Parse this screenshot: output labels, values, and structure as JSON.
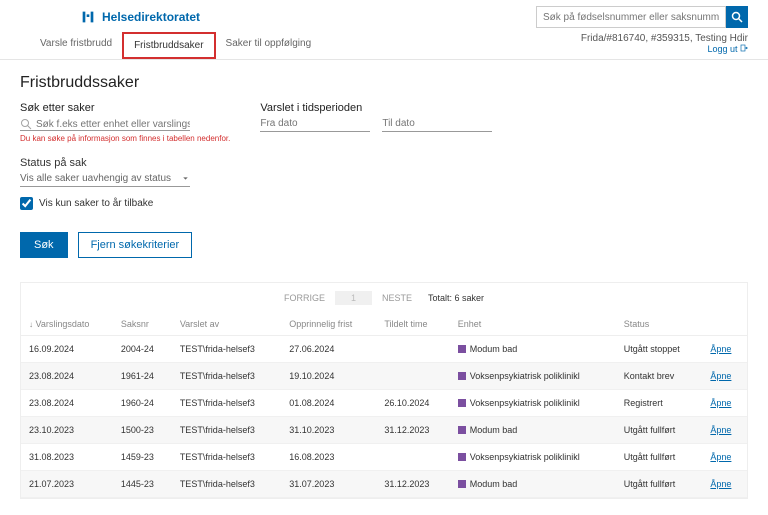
{
  "brand": "Helsedirektoratet",
  "top_search": {
    "placeholder": "Søk på fødselsnummer eller saksnummer"
  },
  "tabs": {
    "t0": "Varsle fristbrudd",
    "t1": "Fristbruddsaker",
    "t2": "Saker til oppfølging"
  },
  "user_line": "Frida/#816740, #359315, Testing Hdir",
  "logout": "Logg ut",
  "page_title": "Fristbruddssaker",
  "search_label": "Søk etter saker",
  "search_placeholder": "Søk f.eks etter enhet eller varslingsdato",
  "search_hint": "Du kan søke på informasjon som finnes i tabellen nedenfor.",
  "period_label": "Varslet i tidsperioden",
  "from_placeholder": "Fra dato",
  "to_placeholder": "Til dato",
  "status_label": "Status på sak",
  "status_value": "Vis alle saker uavhengig av status",
  "checkbox_label": "Vis kun saker to år tilbake",
  "btn_search": "Søk",
  "btn_clear": "Fjern søkekriterier",
  "pager": {
    "prev": "FORRIGE",
    "page": "1",
    "next": "NESTE",
    "total": "Totalt: 6 saker"
  },
  "columns": {
    "c0": "Varslingsdato",
    "c1": "Saksnr",
    "c2": "Varslet av",
    "c3": "Opprinnelig frist",
    "c4": "Tildelt time",
    "c5": "Enhet",
    "c6": "Status",
    "c7": ""
  },
  "apne": "Åpne",
  "rows": [
    {
      "d": "16.09.2024",
      "s": "2004-24",
      "v": "TEST\\frida-helsef3",
      "of": "27.06.2024",
      "tt": "",
      "e": "Modum bad",
      "st": "Utgått stoppet"
    },
    {
      "d": "23.08.2024",
      "s": "1961-24",
      "v": "TEST\\frida-helsef3",
      "of": "19.10.2024",
      "tt": "",
      "e": "Voksenpsykiatrisk poliklinikl",
      "st": "Kontakt brev"
    },
    {
      "d": "23.08.2024",
      "s": "1960-24",
      "v": "TEST\\frida-helsef3",
      "of": "01.08.2024",
      "tt": "26.10.2024",
      "e": "Voksenpsykiatrisk poliklinikl",
      "st": "Registrert"
    },
    {
      "d": "23.10.2023",
      "s": "1500-23",
      "v": "TEST\\frida-helsef3",
      "of": "31.10.2023",
      "tt": "31.12.2023",
      "e": "Modum bad",
      "st": "Utgått fullført"
    },
    {
      "d": "31.08.2023",
      "s": "1459-23",
      "v": "TEST\\frida-helsef3",
      "of": "16.08.2023",
      "tt": "",
      "e": "Voksenpsykiatrisk poliklinikl",
      "st": "Utgått fullført"
    },
    {
      "d": "21.07.2023",
      "s": "1445-23",
      "v": "TEST\\frida-helsef3",
      "of": "31.07.2023",
      "tt": "31.12.2023",
      "e": "Modum bad",
      "st": "Utgått fullført"
    }
  ]
}
